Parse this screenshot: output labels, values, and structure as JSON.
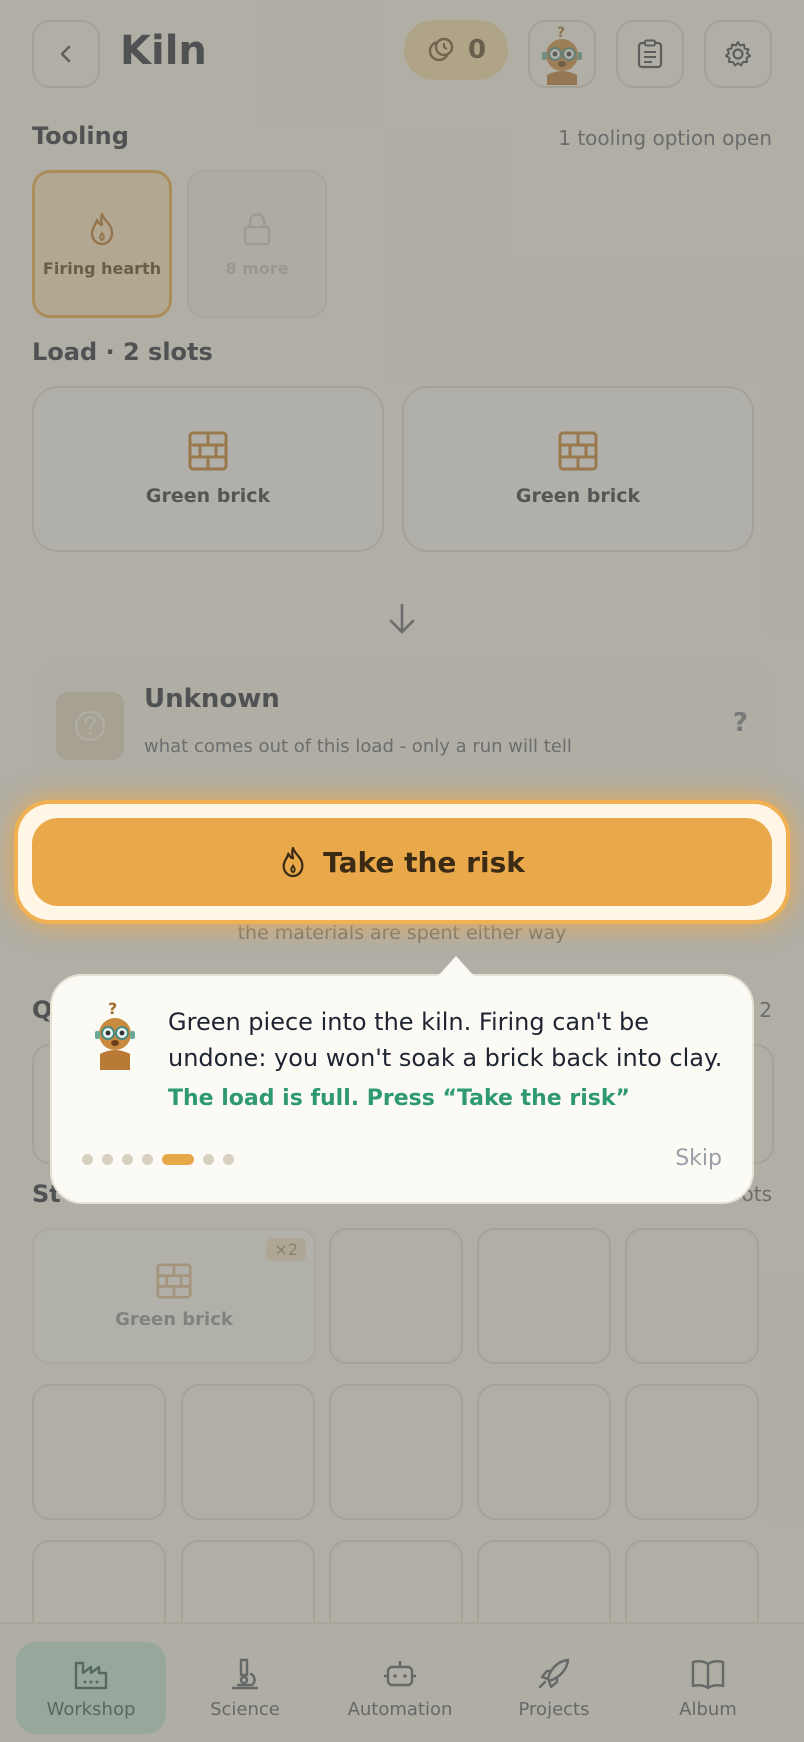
{
  "header": {
    "title": "Kiln",
    "coins": "0"
  },
  "tooling": {
    "title": "Tooling",
    "meta": "1 tooling option open",
    "items": [
      {
        "label": "Firing hearth",
        "icon": "flame-icon"
      },
      {
        "label": "8 more",
        "icon": "lock-icon"
      }
    ]
  },
  "load": {
    "title": "Load · 2 slots",
    "slots": [
      {
        "label": "Green brick",
        "icon": "brick-icon"
      },
      {
        "label": "Green brick",
        "icon": "brick-icon"
      }
    ]
  },
  "result": {
    "title": "Unknown",
    "desc": "what comes out of this load - only a run will tell",
    "mark": "?"
  },
  "action": {
    "label": "Take the risk",
    "caption": "the materials are spent either way"
  },
  "partial": {
    "q_title": "Q",
    "q_meta": "2",
    "st_title": "St",
    "st_meta": "ots"
  },
  "stock": {
    "item_label": "Green brick",
    "item_count": "×2"
  },
  "tooltip": {
    "text": "Green piece into the kiln. Firing can't be undone: you won't soak a brick back into clay.",
    "hint": "The load is full. Press “Take the risk”",
    "skip": "Skip",
    "steps": 7,
    "current_step": 5
  },
  "nav": {
    "items": [
      {
        "label": "Workshop",
        "icon": "factory-icon",
        "active": true
      },
      {
        "label": "Science",
        "icon": "microscope-icon"
      },
      {
        "label": "Automation",
        "icon": "robot-icon"
      },
      {
        "label": "Projects",
        "icon": "rocket-icon"
      },
      {
        "label": "Album",
        "icon": "book-icon"
      }
    ]
  },
  "colors": {
    "accent": "#e9a94b",
    "hint": "#2f9a72",
    "active_nav": "#bfe3d6"
  }
}
